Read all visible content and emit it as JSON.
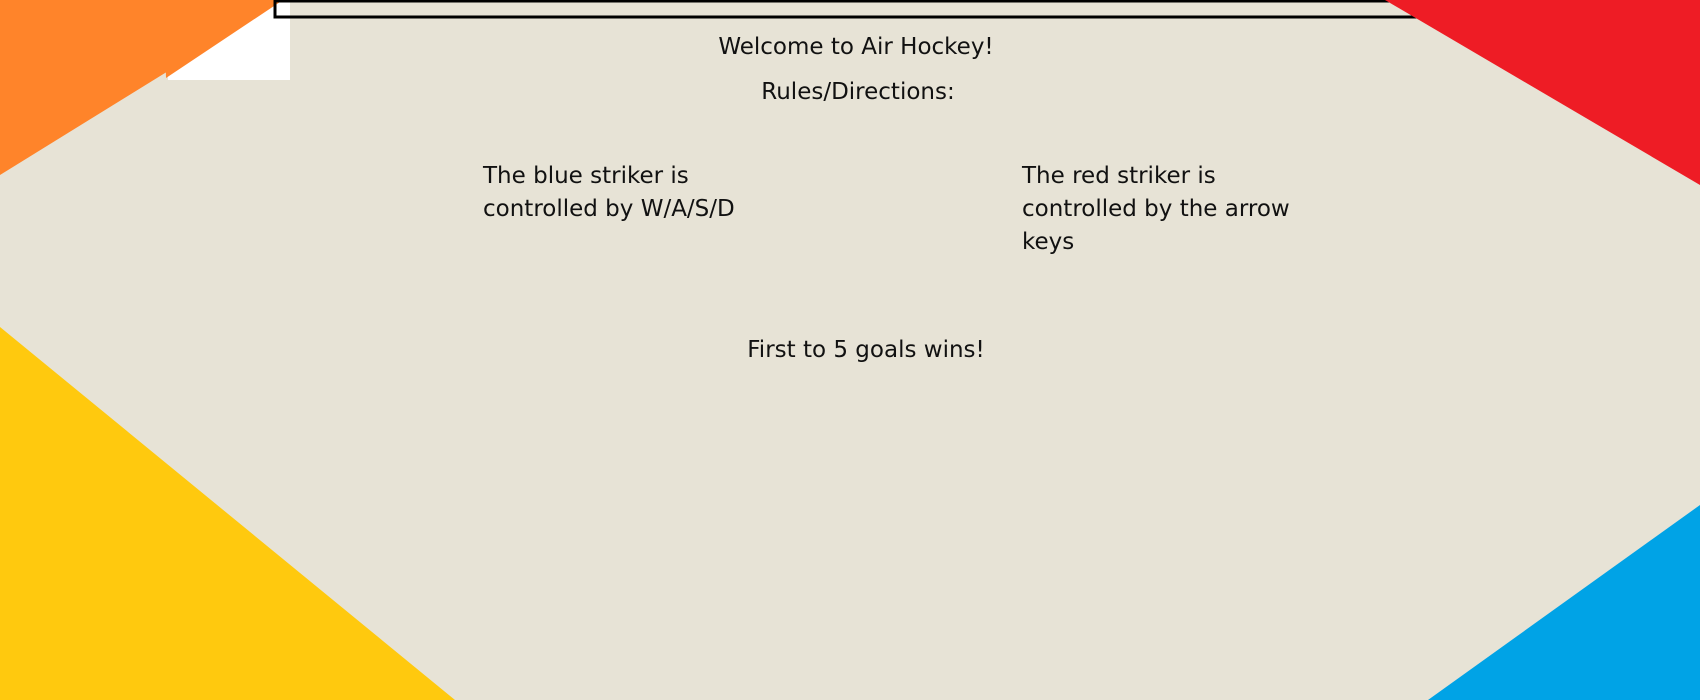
{
  "colors": {
    "background": "#e7e3d6",
    "orange": "#ff842a",
    "red": "#ee1c25",
    "yellow": "#ffc90e",
    "blue": "#00a3e6",
    "white": "#ffffff",
    "outline": "#000000"
  },
  "welcome_text": "Welcome to Air Hockey!",
  "rules_heading": "Rules/Directions:",
  "blue_controls": {
    "line1": "The blue striker is",
    "line2": "controlled by W/A/S/D"
  },
  "red_controls": {
    "line1": "The red striker is",
    "line2": "controlled by the arrow",
    "line3": "keys"
  },
  "win_condition": "First to 5 goals wins!"
}
